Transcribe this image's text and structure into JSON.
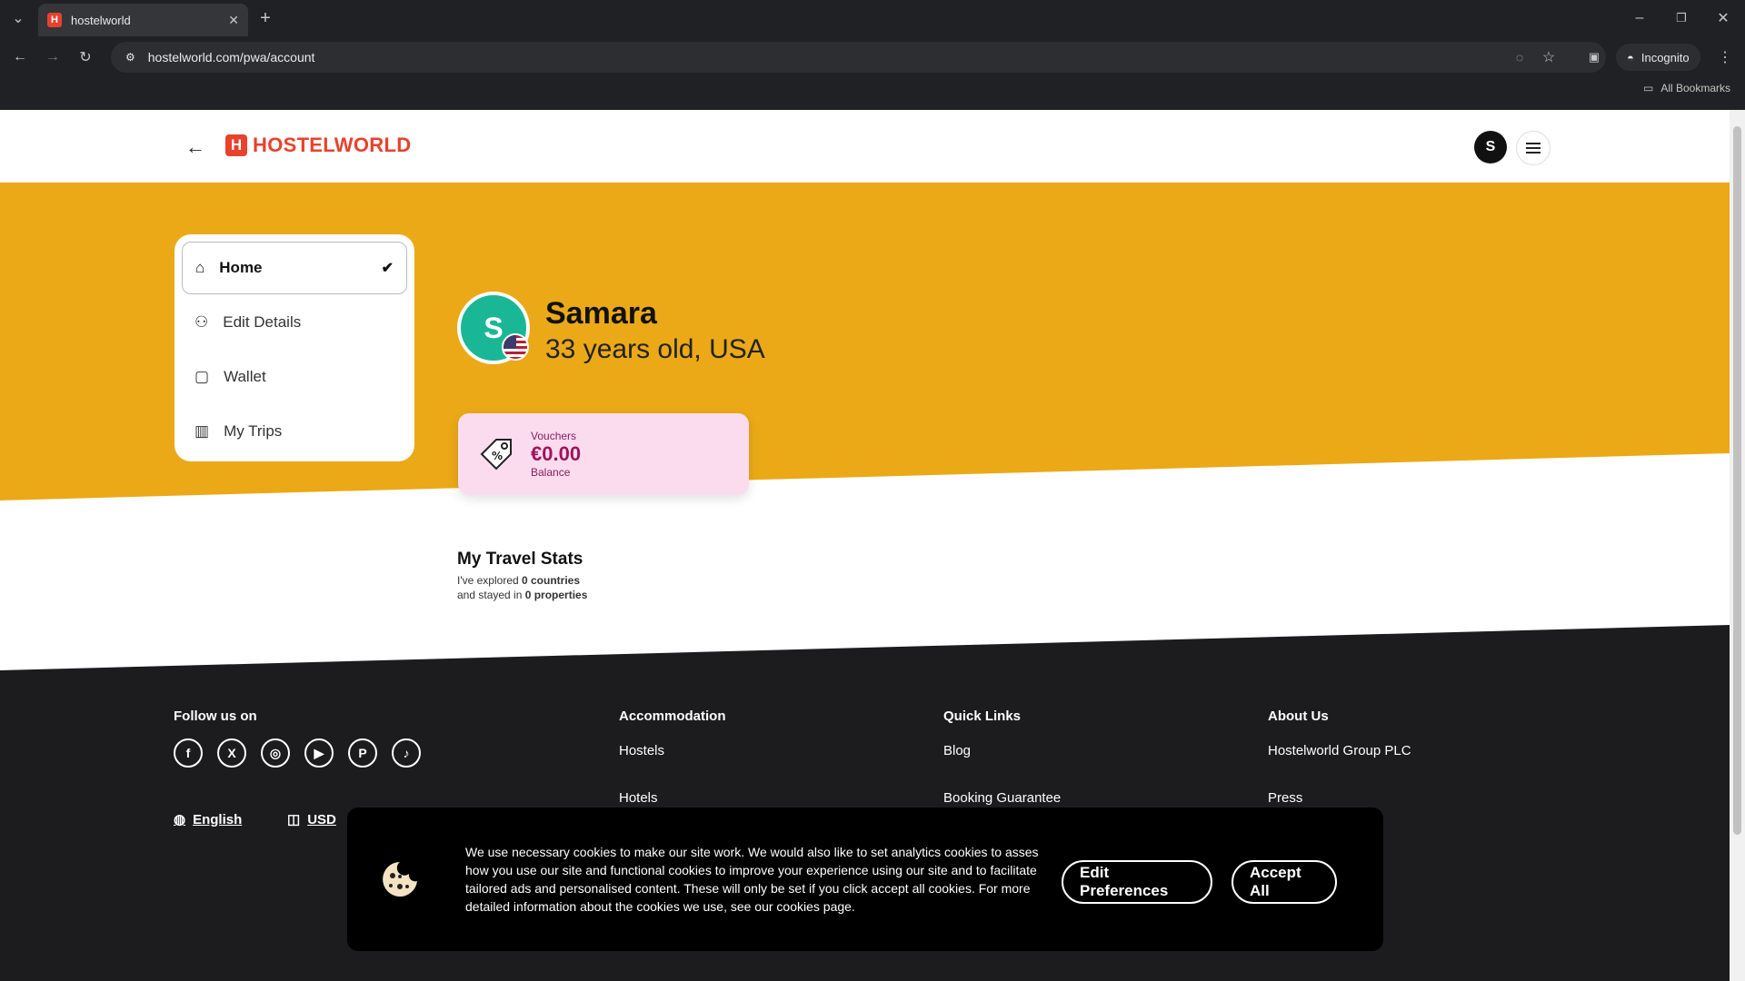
{
  "browser": {
    "tab_title": "hostelworld",
    "favicon_letter": "H",
    "url": "hostelworld.com/pwa/account",
    "incognito_label": "Incognito",
    "bookmarks_label": "All Bookmarks"
  },
  "header": {
    "logo_letter": "H",
    "logo_text": "HOSTELWORLD",
    "avatar_initial": "S"
  },
  "colors": {
    "hero_bg": "#EBA917",
    "brand_red": "#E8412C",
    "footer_bg": "#1C1C1F",
    "avatar_green": "#1AB797",
    "voucher_bg": "#FBDCEF"
  },
  "sidebar": {
    "items": [
      {
        "label": "Home",
        "icon": "home-icon",
        "active": true
      },
      {
        "label": "Edit Details",
        "icon": "user-icon",
        "active": false
      },
      {
        "label": "Wallet",
        "icon": "wallet-icon",
        "active": false
      },
      {
        "label": "My Trips",
        "icon": "map-icon",
        "active": false
      }
    ]
  },
  "profile": {
    "initial": "S",
    "name": "Samara",
    "meta": "33 years old, USA"
  },
  "voucher": {
    "label": "Vouchers",
    "amount": "€0.00",
    "sublabel": "Balance"
  },
  "stats": {
    "title": "My Travel Stats",
    "line1_prefix": "I've explored ",
    "line1_value": "0 countries",
    "line2_prefix": "and stayed in ",
    "line2_value": "0 properties"
  },
  "footer": {
    "follow_title": "Follow us on",
    "socials": [
      "facebook-icon",
      "x-icon",
      "instagram-icon",
      "youtube-icon",
      "pinterest-icon",
      "tiktok-icon"
    ],
    "language": "English",
    "currency": "USD",
    "accommodation": {
      "title": "Accommodation",
      "links": [
        "Hostels",
        "Hotels"
      ]
    },
    "quick_links": {
      "title": "Quick Links",
      "links": [
        "Blog",
        "Booking Guarantee"
      ]
    },
    "about": {
      "title": "About Us",
      "links": [
        "Hostelworld Group PLC",
        "Press"
      ]
    }
  },
  "cookie": {
    "text": "We use necessary cookies to make our site work. We would also like to set analytics cookies to asses how you use our site and functional cookies to improve your experience using our site and to facilitate tailored ads and personalised content. These will only be set if you click accept all cookies. For more detailed information about the cookies we use, see our cookies page.",
    "edit_label": "Edit Preferences",
    "accept_label": "Accept All"
  }
}
